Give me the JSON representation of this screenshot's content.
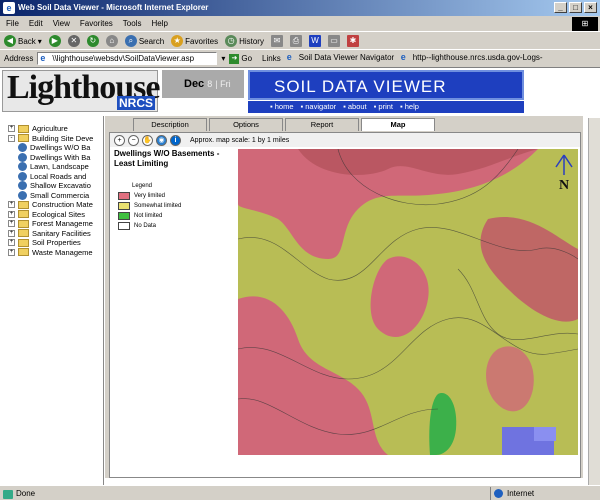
{
  "window": {
    "title": "Web Soil Data Viewer - Microsoft Internet Explorer"
  },
  "menubar": {
    "items": [
      "File",
      "Edit",
      "View",
      "Favorites",
      "Tools",
      "Help"
    ]
  },
  "toolbar": {
    "back": "Back",
    "search": "Search",
    "favorites": "Favorites",
    "history": "History"
  },
  "addressbar": {
    "label": "Address",
    "url": "\\\\lighthouse\\websdv\\SoilDataViewer.asp",
    "go": "Go",
    "links_label": "Links",
    "link1": "Soil Data Viewer Navigator",
    "link2": "http--lighthouse.nrcs.usda.gov-Logs-"
  },
  "banner": {
    "logo": "Lighthouse",
    "nrcs": "NRCS",
    "date_month": "Dec",
    "date_day": "8",
    "date_weekday": "Fri",
    "title": "SOIL DATA VIEWER",
    "nav": [
      "home",
      "navigator",
      "about",
      "print",
      "help"
    ]
  },
  "sidebar": {
    "items": [
      {
        "label": "Agriculture",
        "type": "folder",
        "expander": "+"
      },
      {
        "label": "Building Site Deve",
        "type": "folder",
        "expander": "-"
      },
      {
        "label": "Dwellings W/O Ba",
        "type": "leaf"
      },
      {
        "label": "Dwellings With Ba",
        "type": "leaf"
      },
      {
        "label": "Lawn, Landscape",
        "type": "leaf"
      },
      {
        "label": "Local Roads and",
        "type": "leaf"
      },
      {
        "label": "Shallow Excavatio",
        "type": "leaf"
      },
      {
        "label": "Small Commercia",
        "type": "leaf"
      },
      {
        "label": "Construction Mate",
        "type": "folder",
        "expander": "+"
      },
      {
        "label": "Ecological Sites",
        "type": "folder",
        "expander": "+"
      },
      {
        "label": "Forest Manageme",
        "type": "folder",
        "expander": "+"
      },
      {
        "label": "Sanitary Facilities",
        "type": "folder",
        "expander": "+"
      },
      {
        "label": "Soil Properties",
        "type": "folder",
        "expander": "+"
      },
      {
        "label": "Waste Manageme",
        "type": "folder",
        "expander": "+"
      }
    ]
  },
  "tabs": [
    {
      "label": "Description"
    },
    {
      "label": "Options"
    },
    {
      "label": "Report"
    },
    {
      "label": "Map",
      "active": true
    }
  ],
  "map": {
    "scale_text": "Approx. map scale: 1 by 1 miles",
    "title": "Dwellings W/O Basements - Least Limiting",
    "legend_title": "Legend",
    "legend": [
      {
        "label": "Very limited",
        "color": "#e07080"
      },
      {
        "label": "Somewhat limited",
        "color": "#e8e070"
      },
      {
        "label": "Not limited",
        "color": "#40c040"
      },
      {
        "label": "No Data",
        "color": "#ffffff"
      }
    ],
    "north": "N"
  },
  "statusbar": {
    "status": "Done",
    "zone": "Internet"
  }
}
